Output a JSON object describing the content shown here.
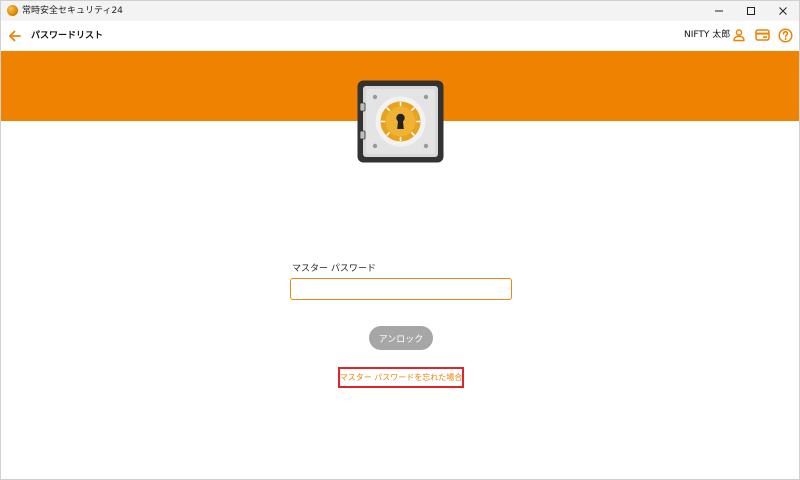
{
  "window": {
    "title": "常時安全セキュリティ24",
    "controls": {
      "minimize": "minimize",
      "maximize": "maximize",
      "close": "close"
    }
  },
  "header": {
    "title": "パスワードリスト",
    "user_name": "NIFTY 太郎",
    "icons": [
      "back-arrow-icon",
      "user-icon",
      "card-icon",
      "help-icon"
    ]
  },
  "form": {
    "label": "マスター パスワード",
    "value": "",
    "placeholder": "",
    "unlock_label": "アンロック",
    "forgot_link": "マスター パスワードを忘れた場合"
  },
  "colors": {
    "accent": "#ef8200",
    "button_disabled": "#a6a6a6",
    "highlight_box": "#e0242c",
    "safe_body": "#d8d8d8",
    "safe_frame": "#333333",
    "dial": "#e8a21c"
  }
}
